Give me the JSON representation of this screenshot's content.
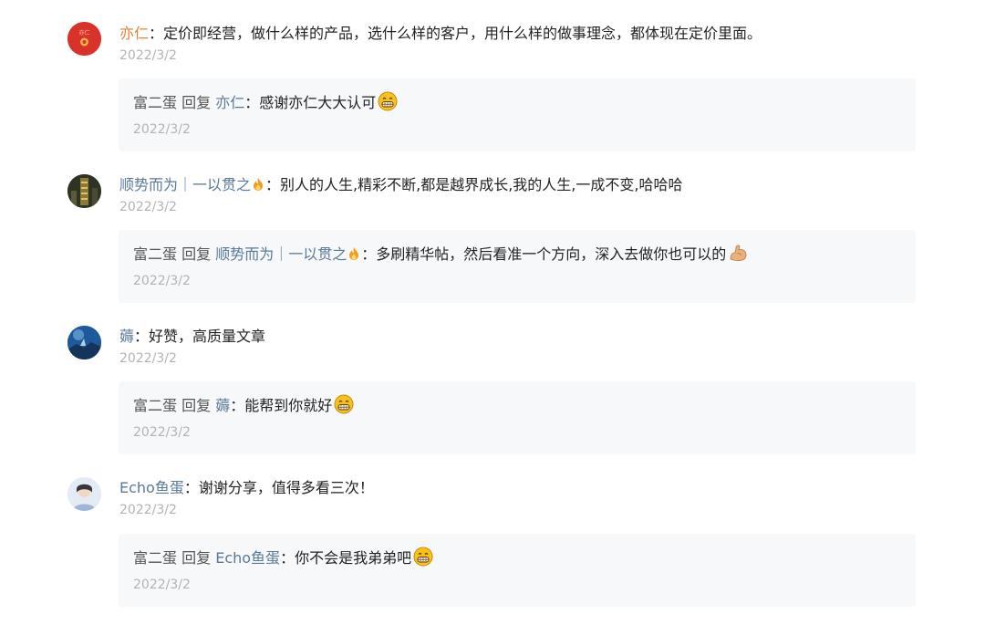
{
  "reply_word": "回复",
  "comments": [
    {
      "author": "亦仁",
      "separator": "：",
      "text": "定价即经营，做什么样的产品，选什么样的客户，用什么样的做事理念，都体现在定价里面。",
      "date": "2022/3/2",
      "avatar_label": "亦仁",
      "reply": {
        "author": "富二蛋",
        "to": "亦仁",
        "separator": "：",
        "text": "感谢亦仁大大认可",
        "date": "2022/3/2",
        "emoji": "grin-emoji"
      }
    },
    {
      "author": "顺势而为｜一以贯之",
      "separator": "：",
      "text": "别人的人生,精彩不断,都是越界成长,我的人生,一成不变,哈哈哈",
      "date": "2022/3/2",
      "reply": {
        "author": "富二蛋",
        "to": "顺势而为｜一以贯之",
        "separator": "：",
        "text": "多刷精华帖，然后看准一个方向，深入去做你也可以的",
        "date": "2022/3/2",
        "emoji": "flexed-biceps-emoji"
      }
    },
    {
      "author": "薅",
      "separator": "：",
      "text": "好赞，高质量文章",
      "date": "2022/3/2",
      "reply": {
        "author": "富二蛋",
        "to": "薅",
        "separator": "：",
        "text": "能帮到你就好",
        "date": "2022/3/2",
        "emoji": "grin-emoji"
      }
    },
    {
      "author": "Echo鱼蛋",
      "separator": "：",
      "text": "谢谢分享，值得多看三次！",
      "date": "2022/3/2",
      "reply": {
        "author": "富二蛋",
        "to": "Echo鱼蛋",
        "separator": "：",
        "text": "你不会是我弟弟吧",
        "date": "2022/3/2",
        "emoji": "grin-emoji"
      }
    }
  ],
  "colors": {
    "name_blue": "#5a7a99",
    "name_orange": "#e57f3c",
    "date_gray": "#b3b3b3",
    "reply_bg": "#f6f8fa"
  }
}
